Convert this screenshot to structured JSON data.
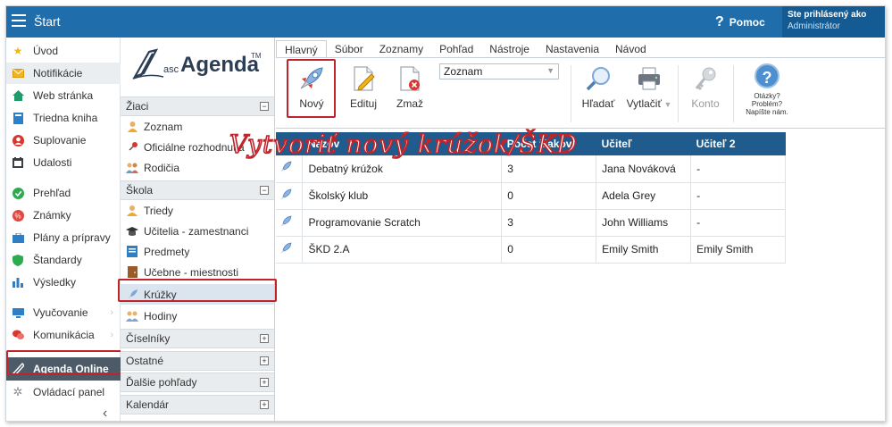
{
  "topbar": {
    "title": "Štart",
    "help_label": "Pomoc",
    "user_line1": "Ste prihlásený ako",
    "user_line2": "Administrátor"
  },
  "left_nav": [
    {
      "label": "Úvod",
      "icon": "star-icon"
    },
    {
      "label": "Notifikácie",
      "icon": "envelope-icon"
    },
    {
      "label": "Web stránka",
      "icon": "home-icon"
    },
    {
      "label": "Triedna kniha",
      "icon": "book-icon"
    },
    {
      "label": "Suplovanie",
      "icon": "person-icon"
    },
    {
      "label": "Udalosti",
      "icon": "calendar-icon"
    },
    {
      "label": "Prehľad",
      "icon": "check-circle-icon"
    },
    {
      "label": "Známky",
      "icon": "grades-icon"
    },
    {
      "label": "Plány a prípravy",
      "icon": "briefcase-icon"
    },
    {
      "label": "Štandardy",
      "icon": "shield-icon"
    },
    {
      "label": "Výsledky",
      "icon": "bar-chart-icon"
    },
    {
      "label": "Vyučovanie",
      "icon": "monitor-icon"
    },
    {
      "label": "Komunikácia",
      "icon": "chat-icon"
    },
    {
      "label": "Agenda Online",
      "icon": "pen-icon"
    },
    {
      "label": "Ovládací panel",
      "icon": "gear-icon"
    }
  ],
  "logo": {
    "prefix": "asc",
    "name": "Agenda",
    "tm": "TM"
  },
  "mid_nav": {
    "ziaci": {
      "label": "Žiaci",
      "items": [
        "Zoznam",
        "Oficiálne rozhodnutia",
        "Rodičia"
      ]
    },
    "skola": {
      "label": "Škola",
      "items": [
        "Triedy",
        "Učitelia - zamestnanci",
        "Predmety",
        "Učebne - miestnosti",
        "Krúžky",
        "Hodiny"
      ]
    },
    "ciselniky": "Číselníky",
    "ostatne": "Ostatné",
    "dalsie": "Ďalšie pohľady",
    "kalendar": "Kalendár"
  },
  "ribbon": {
    "tabs": [
      "Hlavný",
      "Súbor",
      "Zoznamy",
      "Pohľad",
      "Nástroje",
      "Nastavenia",
      "Návod"
    ],
    "buttons": {
      "new": "Nový",
      "edit": "Edituj",
      "delete": "Zmaž",
      "find": "Hľadať",
      "print": "Vytlačiť",
      "account": "Konto"
    },
    "view_select": "Zoznam",
    "faq": [
      "Otázky?",
      "Problém?",
      "Napíšte nám."
    ]
  },
  "annotation": "Vytvoriť nový krúžok/ŠKD",
  "table": {
    "headers": [
      "",
      "Názov",
      "Počet žiakov",
      "Učiteľ",
      "Učiteľ 2"
    ],
    "rows": [
      [
        "Debatný krúžok",
        "3",
        "Jana Nováková",
        "-"
      ],
      [
        "Školský klub",
        "0",
        "Adela Grey",
        "-"
      ],
      [
        "Programovanie Scratch",
        "3",
        "John Williams",
        "-"
      ],
      [
        "ŠKD 2.A",
        "0",
        "Emily Smith",
        "Emily Smith"
      ]
    ]
  },
  "colors": {
    "topbar": "#1f6eab",
    "header": "#1f5b8c",
    "highlight": "#c0242b",
    "selected_nav": "#4d5b69"
  }
}
